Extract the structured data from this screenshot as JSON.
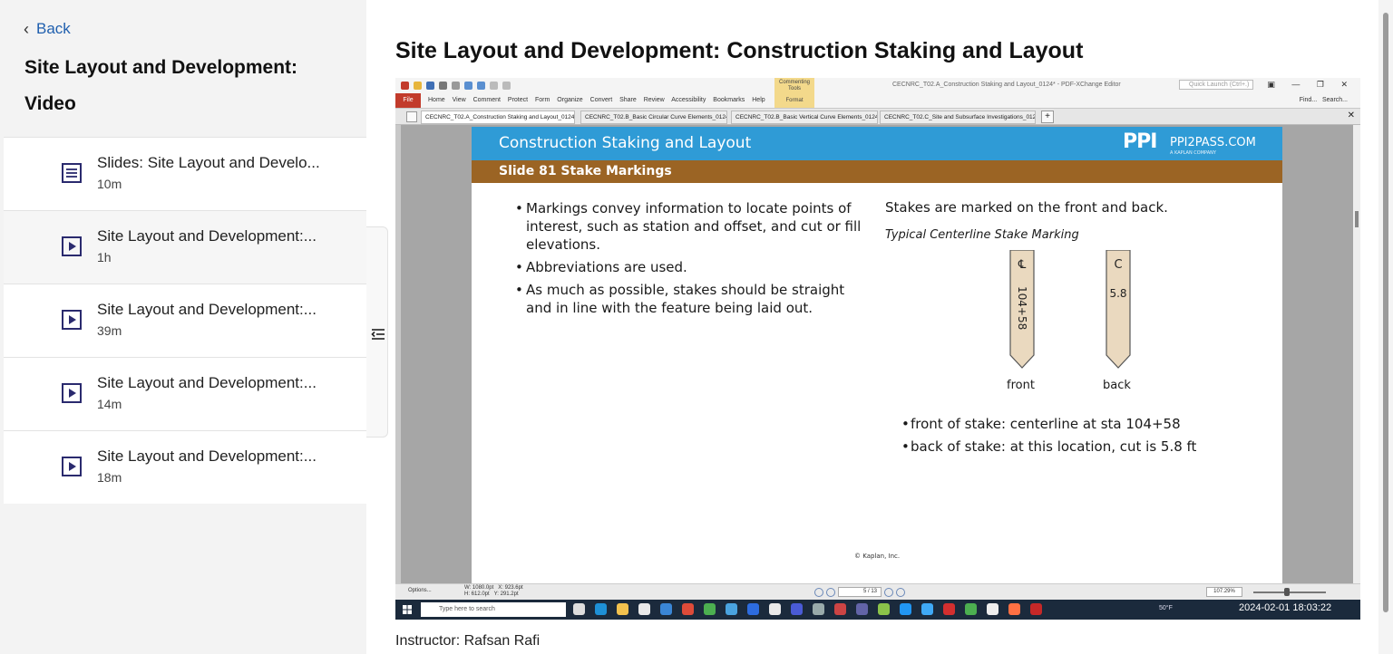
{
  "sidebar": {
    "back_label": "Back",
    "title": "Site Layout and Development: Video",
    "items": [
      {
        "label": "Slides: Site Layout and Develo...",
        "duration": "10m",
        "type": "document"
      },
      {
        "label": "Site Layout and Development:...",
        "duration": "1h",
        "type": "video"
      },
      {
        "label": "Site Layout and Development:...",
        "duration": "39m",
        "type": "video"
      },
      {
        "label": "Site Layout and Development:...",
        "duration": "14m",
        "type": "video"
      },
      {
        "label": "Site Layout and Development:...",
        "duration": "18m",
        "type": "video"
      }
    ]
  },
  "main": {
    "title": "Site Layout and Development: Construction Staking and Layout",
    "instructor": "Instructor: Rafsan Rafi"
  },
  "video": {
    "editor": {
      "window_title": "CECNRC_T02.A_Construction Staking and Layout_0124* - PDF-XChange Editor",
      "quick_launch": "Quick Launch (Ctrl+.)",
      "file_menu": "File",
      "menu": "Home View Comment Protect Form Organize Convert Share Review Accessibility Bookmarks Help",
      "commenting_tools": "Commenting Tools",
      "format_tab": "Format",
      "find": "Find...",
      "search": "Search...",
      "tabs": [
        {
          "label": "CECNRC_T02.A_Construction Staking and Layout_0124 *"
        },
        {
          "label": "CECNRC_T02.B_Basic Circular Curve Elements_0124"
        },
        {
          "label": "CECNRC_T02.B_Basic Vertical Curve Elements_0124"
        },
        {
          "label": "CECNRC_T02.C_Site and Subsurface Investigations_0124"
        }
      ],
      "status": {
        "options": "Options...",
        "w": "W: 1080.0pt",
        "h": "H: 612.0pt",
        "x": "X: 923.6pt",
        "y": "Y: 291.2pt",
        "page": "5 / 13",
        "zoom": "107.29%"
      }
    },
    "slide": {
      "header": "Construction Staking and Layout",
      "brand": "PPI",
      "brand_site": "PPI2PASS.COM",
      "brand_tag": "A KAPLAN COMPANY",
      "subheader": "Slide 81 Stake Markings",
      "bullets": [
        "Markings convey information to locate points of interest, such as station and offset, and cut or fill elevations.",
        "Abbreviations are used.",
        "As much as possible, stakes should be straight and in line with the feature being laid out."
      ],
      "right_heading": "Stakes are marked on the front and back.",
      "figure_caption": "Typical Centerline Stake Marking",
      "front_mark": "℄",
      "front_station": "104+58",
      "back_mark": "C",
      "back_cut": "5.8",
      "front_label": "front",
      "back_label": "back",
      "bullets2": [
        "front of stake: centerline at sta 104+58",
        "back of stake: at this location, cut is 5.8 ft"
      ],
      "copyright": "© Kaplan, Inc."
    },
    "taskbar": {
      "search_placeholder": "Type here to search",
      "weather": "50°F",
      "clock": "2024-02-01 18:03:22"
    }
  },
  "colors": {
    "accent_link": "#1f5fae",
    "slide_blue": "#2f9bd6",
    "slide_brown": "#9b6424",
    "play_icon": "#2a2a6e"
  }
}
